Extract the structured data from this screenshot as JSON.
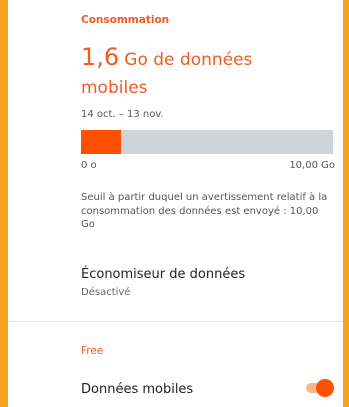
{
  "consumption": {
    "section_title": "Consommation",
    "usage_value": "1,6",
    "usage_text": "Go de données mobiles",
    "period": "14 oct. – 13 nov.",
    "usage_fraction": 0.16,
    "bar_min_label": "0 o",
    "bar_max_label": "10,00 Go",
    "warning_text": "Seuil à partir duquel un avertissement relatif à la consommation des données est envoyé : 10,00 Go"
  },
  "data_saver": {
    "title": "Économiseur de données",
    "status": "Désactivé"
  },
  "operator": {
    "name": "Free",
    "mobile_data_label": "Données mobiles",
    "mobile_data_enabled": true
  },
  "colors": {
    "accent": "#f15a22",
    "bar_fill": "#ff4f00",
    "bar_track": "#ced4da",
    "background_frame": "#f6a21f"
  }
}
